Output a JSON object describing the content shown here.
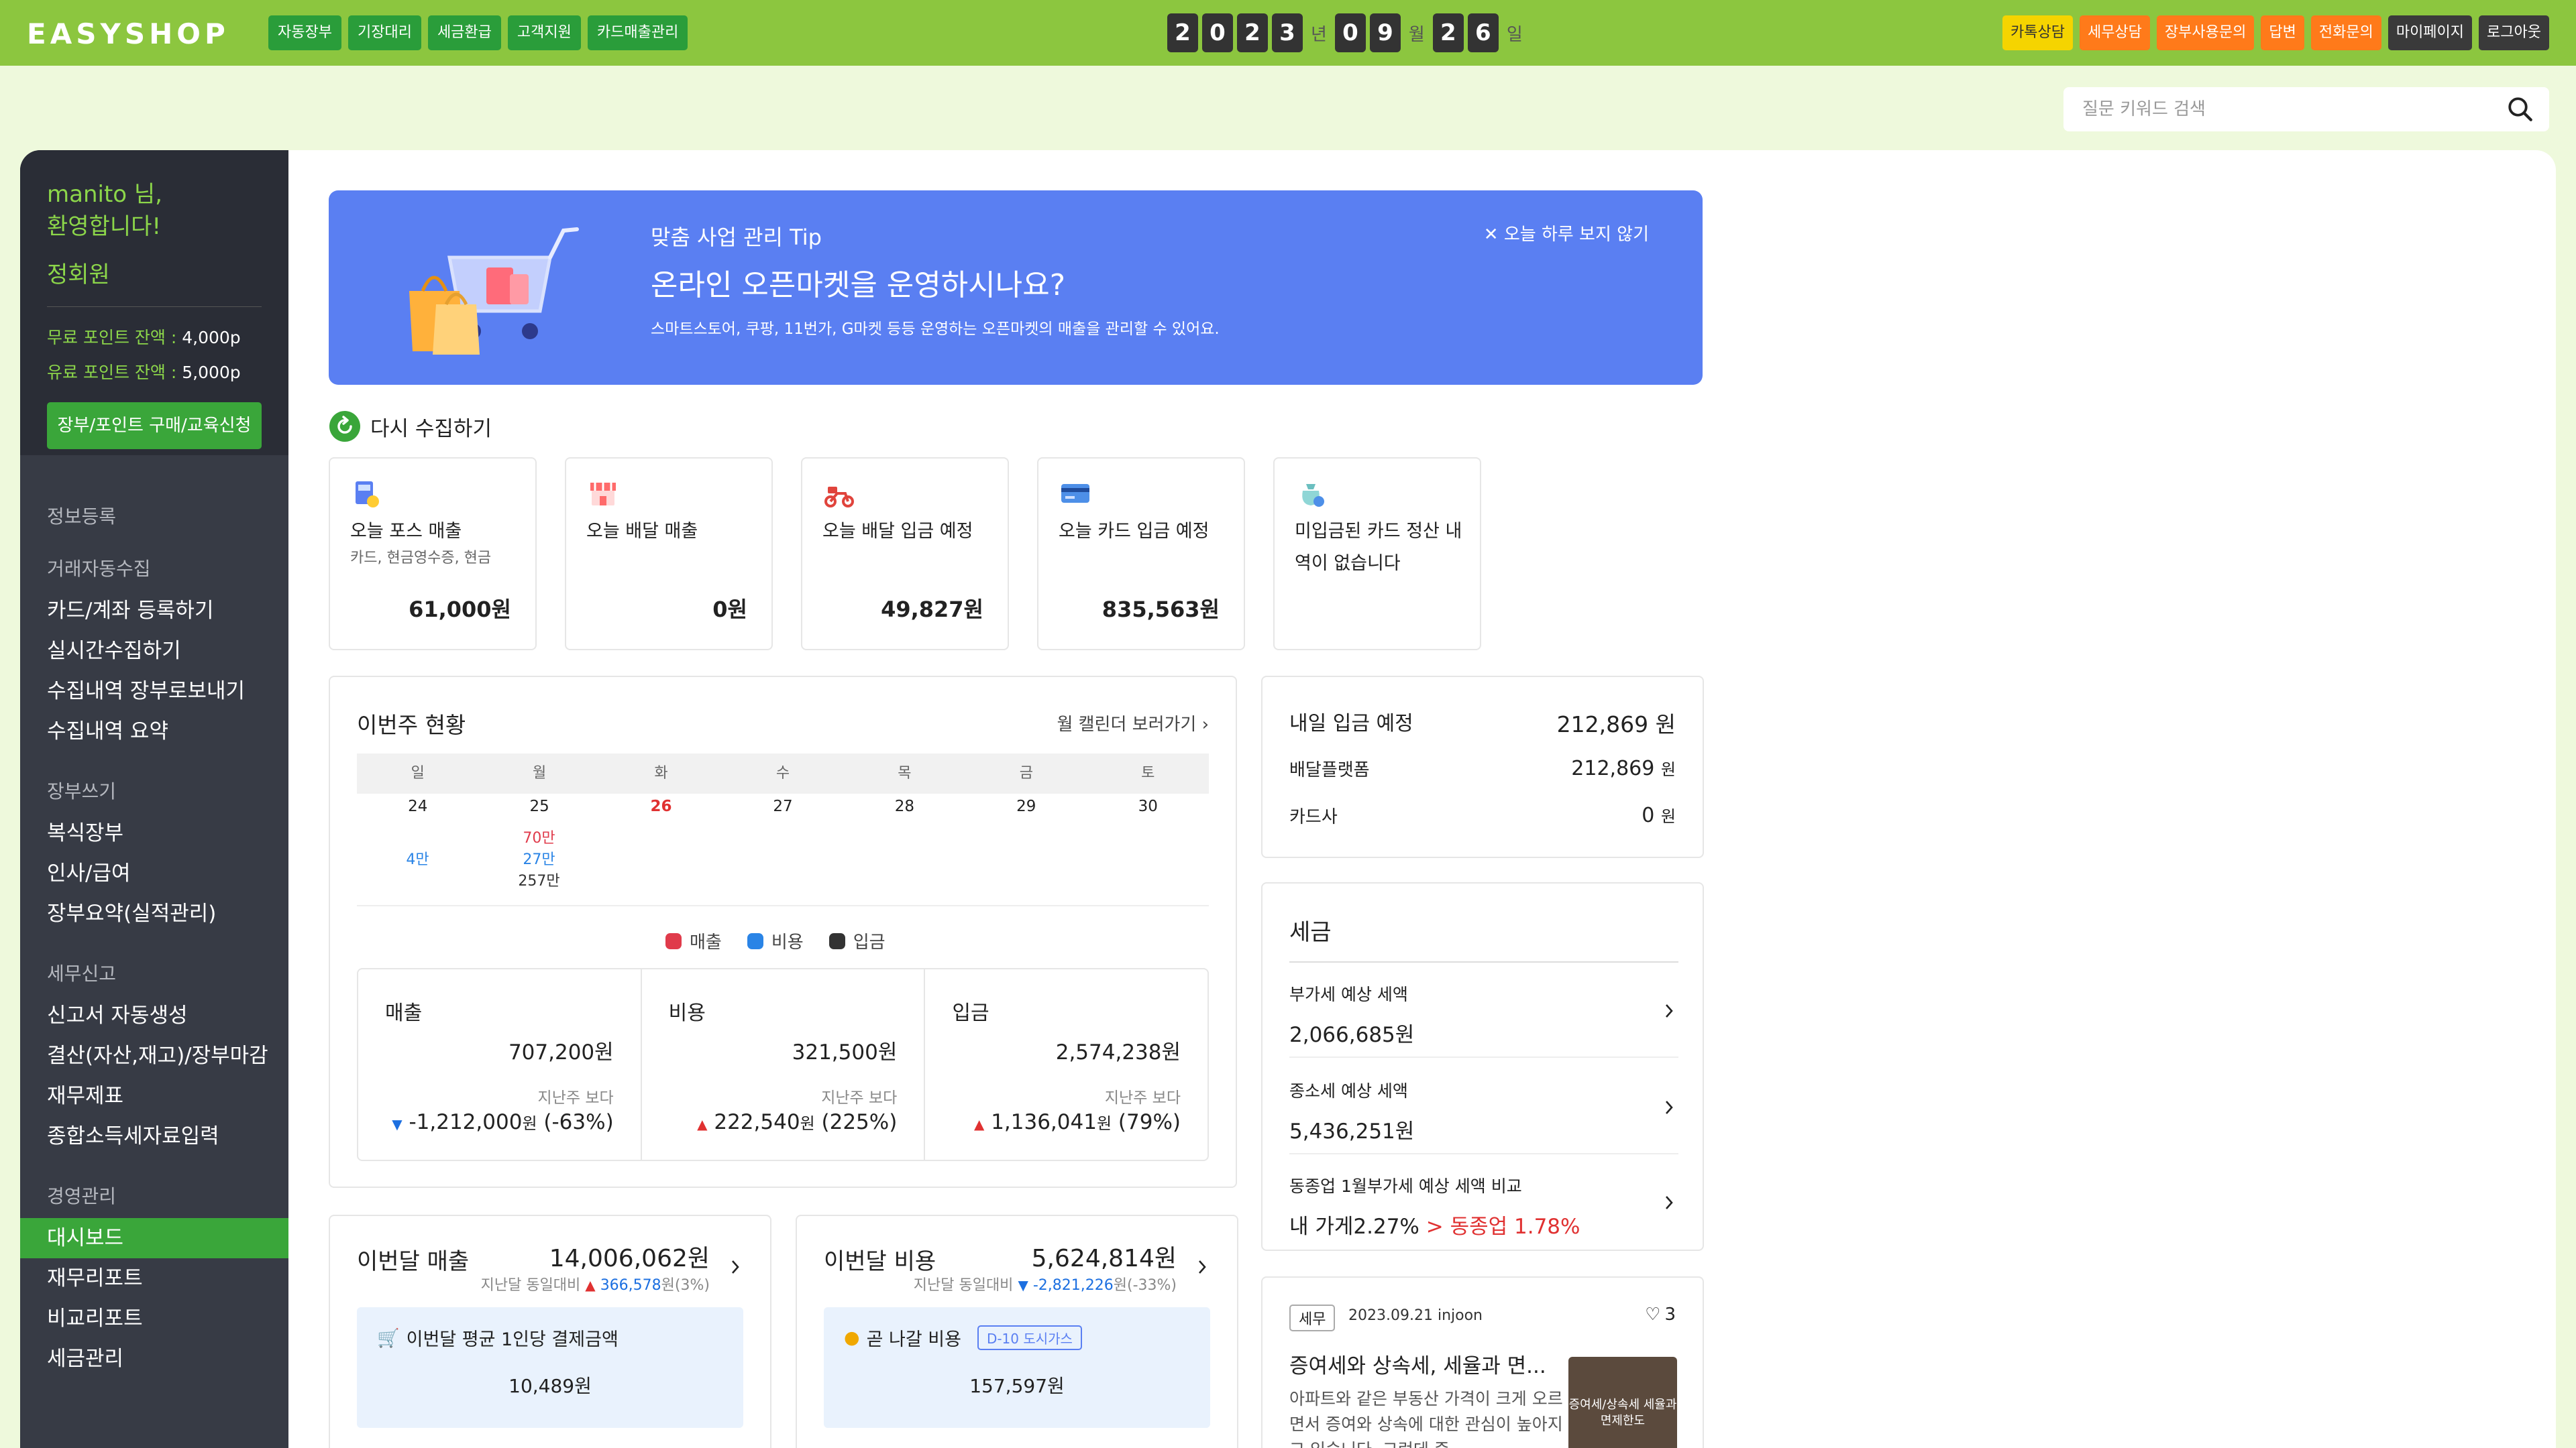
{
  "app": {
    "logo": "EASYSHOP"
  },
  "topnav": [
    "자동장부",
    "기장대리",
    "세금환급",
    "고객지원",
    "카드매출관리"
  ],
  "date": {
    "year_digits": [
      "2",
      "0",
      "2",
      "3"
    ],
    "year_unit": "년",
    "month_digits": [
      "0",
      "9"
    ],
    "month_unit": "월",
    "day_digits": [
      "2",
      "6"
    ],
    "day_unit": "일"
  },
  "rightnav": [
    {
      "label": "카톡상담",
      "color": "#f5d400",
      "text": "#333"
    },
    {
      "label": "세무상담",
      "color": "#ff7a1a",
      "text": "#fff"
    },
    {
      "label": "장부사용문의",
      "color": "#ff7a1a",
      "text": "#fff"
    },
    {
      "label": "답변",
      "color": "#ff7a1a",
      "text": "#fff"
    },
    {
      "label": "전화문의",
      "color": "#ff7a1a",
      "text": "#fff"
    },
    {
      "label": "마이페이지",
      "color": "#3a3a3a",
      "text": "#fff"
    },
    {
      "label": "로그아웃",
      "color": "#3a3a3a",
      "text": "#fff"
    }
  ],
  "search": {
    "placeholder": "질문 키워드 검색",
    "value": ""
  },
  "sidebar": {
    "greeting_line1": "manito 님,",
    "greeting_line2": "환영합니다!",
    "grade": "정회원",
    "free_points_label": "무료 포인트 잔액 :",
    "free_points_value": "4,000p",
    "paid_points_label": "유료 포인트 잔액 :",
    "paid_points_value": "5,000p",
    "buy_button": "장부/포인트 구매/교육신청",
    "menu": [
      {
        "type": "mh",
        "label": "정보등록"
      },
      {
        "type": "mh",
        "label": "거래자동수집"
      },
      {
        "type": "mi",
        "label": "카드/계좌 등록하기"
      },
      {
        "type": "mi",
        "label": "실시간수집하기"
      },
      {
        "type": "mi",
        "label": "수집내역 장부로보내기"
      },
      {
        "type": "mi",
        "label": "수집내역 요약"
      },
      {
        "type": "mh",
        "label": "장부쓰기"
      },
      {
        "type": "mi",
        "label": "복식장부"
      },
      {
        "type": "mi",
        "label": "인사/급여"
      },
      {
        "type": "mi",
        "label": "장부요약(실적관리)"
      },
      {
        "type": "mh",
        "label": "세무신고"
      },
      {
        "type": "mi",
        "label": "신고서 자동생성"
      },
      {
        "type": "mi",
        "label": "결산(자산,재고)/장부마감"
      },
      {
        "type": "mi",
        "label": "재무제표"
      },
      {
        "type": "mi",
        "label": "종합소득세자료입력"
      },
      {
        "type": "mh",
        "label": "경영관리"
      },
      {
        "type": "mi",
        "label": "대시보드",
        "active": true
      },
      {
        "type": "mi",
        "label": "재무리포트"
      },
      {
        "type": "mi",
        "label": "비교리포트"
      },
      {
        "type": "mi",
        "label": "세금관리"
      }
    ]
  },
  "banner": {
    "small": "맞춤 사업 관리 Tip",
    "title": "온라인 오픈마켓을 운영하시나요?",
    "desc": "스마트스토어, 쿠팡, 11번가, G마켓 등등 운영하는 오픈마켓의 매출을 관리할 수 있어요.",
    "close": "오늘 하루 보지 않기"
  },
  "recollect": "다시 수집하기",
  "stats": [
    {
      "title": "오늘 포스 매출",
      "sub": "카드, 현금영수증, 현금",
      "value": "61,000원",
      "icon": "pos-icon"
    },
    {
      "title": "오늘 배달 매출",
      "sub": "",
      "value": "0원",
      "icon": "store-icon"
    },
    {
      "title": "오늘 배달 입금 예정",
      "sub": "",
      "value": "49,827원",
      "icon": "scooter-icon"
    },
    {
      "title": "오늘 카드 입금 예정",
      "sub": "",
      "value": "835,563원",
      "icon": "card-icon"
    },
    {
      "title": "미입금된 카드 정산 내역이 없습니다",
      "sub": "",
      "value": "",
      "icon": "bag-icon"
    }
  ],
  "week": {
    "title": "이번주 현황",
    "link": "월 캘린더 보러가기",
    "days": [
      "일",
      "월",
      "화",
      "수",
      "목",
      "금",
      "토"
    ],
    "dates": [
      "24",
      "25",
      "26",
      "27",
      "28",
      "29",
      "30"
    ],
    "sun_cost": "4만",
    "mon_sales": "70만",
    "mon_cost": "27만",
    "mon_deposit": "257만",
    "legend": [
      {
        "label": "매출",
        "color": "#e03b4b"
      },
      {
        "label": "비용",
        "color": "#2a84e6"
      },
      {
        "label": "입금",
        "color": "#333333"
      }
    ],
    "summary": [
      {
        "label": "매출",
        "value": "707,200원",
        "compare": "지난주 보다",
        "delta": "-1,212,000",
        "unit": "원",
        "pct": "(-63%)",
        "dir": "down"
      },
      {
        "label": "비용",
        "value": "321,500원",
        "compare": "지난주 보다",
        "delta": "222,540",
        "unit": "원",
        "pct": "(225%)",
        "dir": "up"
      },
      {
        "label": "입금",
        "value": "2,574,238원",
        "compare": "지난주 보다",
        "delta": "1,136,041",
        "unit": "원",
        "pct": "(79%)",
        "dir": "up"
      }
    ]
  },
  "tomorrow": {
    "title": "내일 입금 예정",
    "total_value": "212,869",
    "total_unit": "원",
    "rows": [
      {
        "label": "배달플랫폼",
        "value": "212,869",
        "unit": "원"
      },
      {
        "label": "카드사",
        "value": "0",
        "unit": "원"
      }
    ]
  },
  "tax": {
    "title": "세금",
    "items": [
      {
        "label": "부가세 예상 세액",
        "value": "2,066,685원"
      },
      {
        "label": "종소세 예상 세액",
        "value": "5,436,251원"
      }
    ],
    "compare_label": "동종업 1월부가세 예상 세액 비교",
    "compare_mine": "내 가게2.27%",
    "compare_sep": " > ",
    "compare_peer": "동종업 1.78%"
  },
  "month_sales": {
    "title": "이번달 매출",
    "value": "14,006,062원",
    "compare_prefix": "지난달 동일대비",
    "delta": "366,578",
    "delta_unit": "원",
    "pct": "(3%)",
    "box_label": "이번달 평균 1인당 결제금액",
    "box_value": "10,489원"
  },
  "month_cost": {
    "title": "이번달 비용",
    "value": "5,624,814원",
    "compare_prefix": "지난달 동일대비",
    "delta": "-2,821,226",
    "delta_unit": "원",
    "pct": "(-33%)",
    "box_label": "곧 나갈 비용",
    "box_tag": "D-10 도시가스",
    "box_value": "157,597원"
  },
  "post": {
    "tag": "세무",
    "meta": "2023.09.21 injoon",
    "likes": "3",
    "title": "증여세와 상속세, 세율과 면...",
    "desc": "아파트와 같은 부동산 가격이 크게 오르면서 증여와 상속에 대한 관심이 높아지고 있습니다. 그런데 증",
    "thumb_text": "증여세/상속세 세율과 면제한도"
  },
  "colors": {
    "brand_green": "#8cc63f",
    "active_green": "#3aa63a",
    "banner_blue": "#5a7ff2",
    "up_red": "#e03131",
    "down_blue": "#1c6fe0"
  }
}
